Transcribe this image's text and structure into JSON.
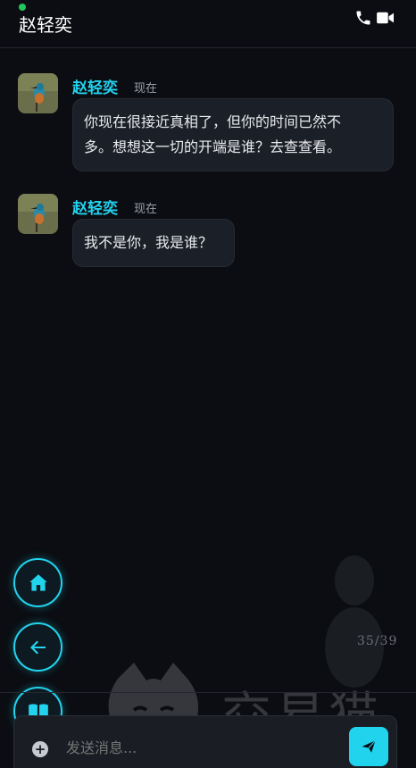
{
  "header": {
    "title": "赵轻奕",
    "online": true,
    "phone_icon": "phone-icon",
    "video_icon": "video-icon"
  },
  "messages": [
    {
      "sender": "赵轻奕",
      "time": "现在",
      "lines": [
        "你现在很接近真相了，但你的时间已然不",
        "多。想想这一切的开端是谁？去查查看。"
      ]
    },
    {
      "sender": "赵轻奕",
      "time": "现在",
      "lines": [
        "我不是你，我是谁？"
      ]
    }
  ],
  "floating_buttons": [
    {
      "icon": "home-icon"
    },
    {
      "icon": "back-arrow-icon"
    },
    {
      "icon": "book-icon"
    }
  ],
  "page_counter": "35/39",
  "watermark": {
    "text": "交易猫"
  },
  "composer": {
    "placeholder": "发送消息...",
    "plus_icon": "plus-icon",
    "send_icon": "send-icon"
  },
  "colors": {
    "accent": "#22d3ee",
    "background": "#0b0d12",
    "bubble": "#1b1f27",
    "online": "#22c55e"
  }
}
